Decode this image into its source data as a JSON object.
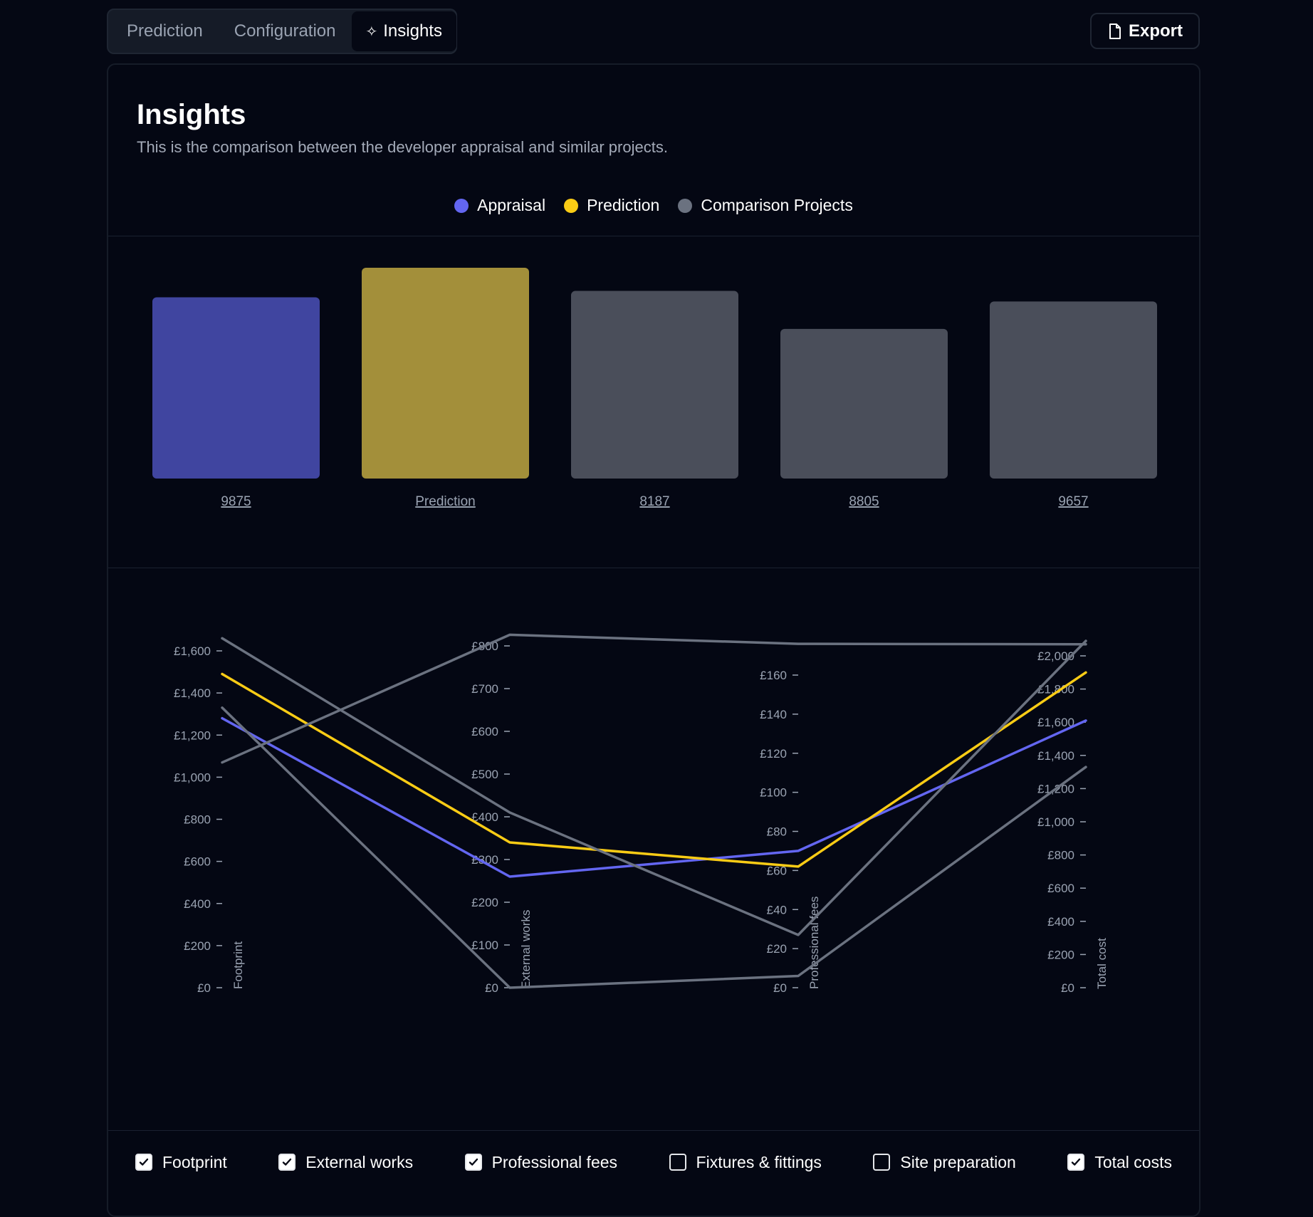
{
  "tabs": [
    {
      "label": "Prediction"
    },
    {
      "label": "Configuration"
    },
    {
      "label": "Insights"
    }
  ],
  "export_label": "Export",
  "card": {
    "title": "Insights",
    "subtitle": "This is the comparison between the developer appraisal and similar projects."
  },
  "legend": [
    {
      "label": "Appraisal",
      "color": "#6366f1"
    },
    {
      "label": "Prediction",
      "color": "#facc15"
    },
    {
      "label": "Comparison Projects",
      "color": "#6b7280"
    }
  ],
  "checkboxes": [
    {
      "label": "Footprint",
      "checked": true
    },
    {
      "label": "External works",
      "checked": true
    },
    {
      "label": "Professional fees",
      "checked": true
    },
    {
      "label": "Fixtures & fittings",
      "checked": false
    },
    {
      "label": "Site preparation",
      "checked": false
    },
    {
      "label": "Total costs",
      "checked": true
    }
  ],
  "chart_data": [
    {
      "type": "bar",
      "categories": [
        "9875",
        "Prediction",
        "8187",
        "8805",
        "9657"
      ],
      "values": [
        0.86,
        1.0,
        0.89,
        0.71,
        0.84
      ],
      "value_note": "relative heights; no value axis shown",
      "colors": [
        "#4045a0",
        "#a38f3a",
        "#4a4e5a",
        "#4a4e5a",
        "#4a4e5a"
      ]
    },
    {
      "type": "line",
      "chart_kind": "parallel-coordinates",
      "axes": [
        {
          "label": "Footprint",
          "ticks": [
            "£0",
            "£200",
            "£400",
            "£600",
            "£800",
            "£1,000",
            "£1,200",
            "£1,400",
            "£1,600"
          ],
          "range": [
            0,
            1660
          ]
        },
        {
          "label": "External works",
          "ticks": [
            "£0",
            "£100",
            "£200",
            "£300",
            "£400",
            "£500",
            "£600",
            "£700",
            "£800"
          ],
          "range": [
            0,
            826
          ]
        },
        {
          "label": "Professional fees",
          "ticks": [
            "£0",
            "£20",
            "£40",
            "£60",
            "£80",
            "£100",
            "£120",
            "£140",
            "£160"
          ],
          "range": [
            0,
            176
          ]
        },
        {
          "label": "Total cost",
          "ticks": [
            "£0",
            "£200",
            "£400",
            "£600",
            "£800",
            "£1,000",
            "£1,200",
            "£1,400",
            "£1,600",
            "£1,800",
            "£2,000"
          ],
          "range": [
            0,
            2090
          ]
        }
      ],
      "series": [
        {
          "name": "Appraisal",
          "color": "#6366f1",
          "values": [
            1280,
            260,
            70,
            1610
          ]
        },
        {
          "name": "Prediction",
          "color": "#facc15",
          "values": [
            1490,
            340,
            62,
            1900
          ]
        },
        {
          "color": "#6b7280",
          "values": [
            1070,
            826,
            176,
            2070
          ]
        },
        {
          "color": "#6b7280",
          "values": [
            1660,
            410,
            27,
            2090
          ]
        },
        {
          "color": "#6b7280",
          "values": [
            1330,
            0,
            6,
            1330
          ]
        }
      ]
    }
  ]
}
